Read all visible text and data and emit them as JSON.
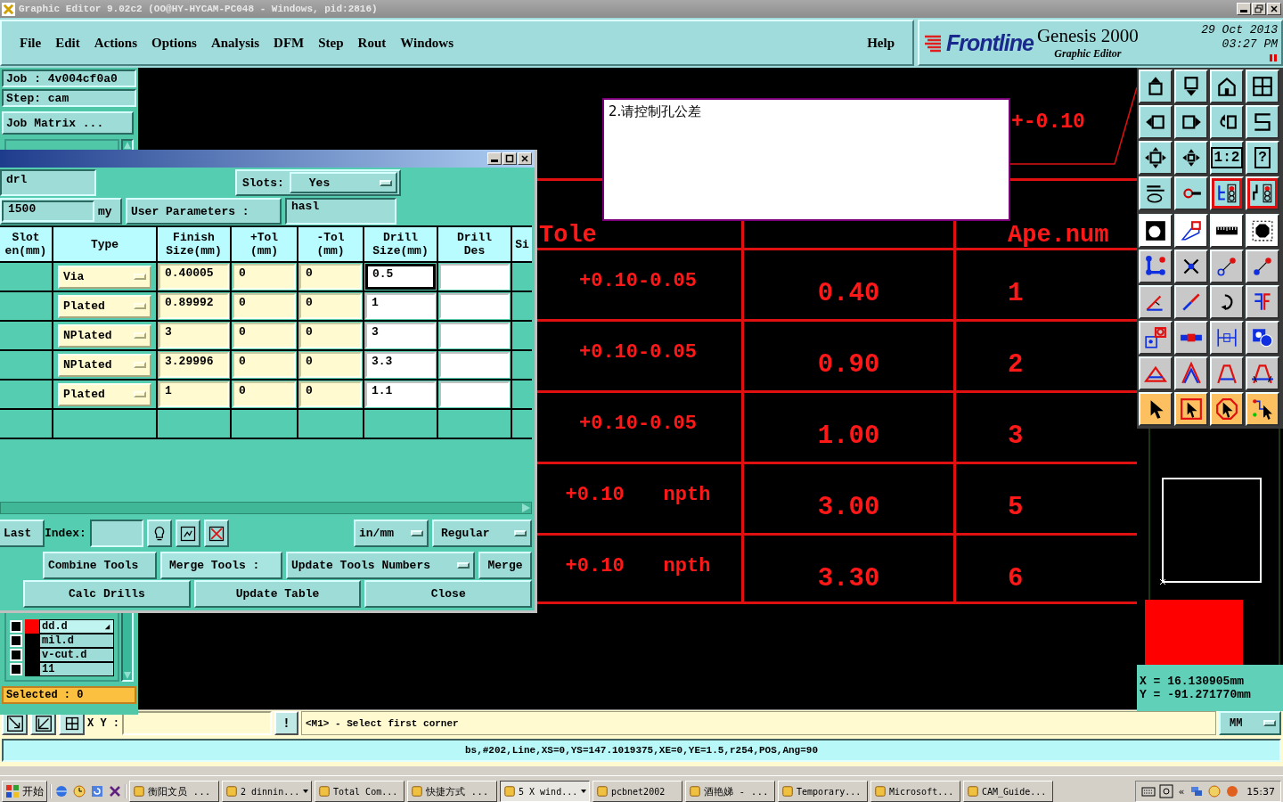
{
  "window": {
    "title": "Graphic Editor 9.02c2 (OO@HY-HYCAM-PC048 - Windows, pid:2816)"
  },
  "menu": [
    "File",
    "Edit",
    "Actions",
    "Options",
    "Analysis",
    "DFM",
    "Step",
    "Rout",
    "Windows"
  ],
  "help": "Help",
  "brand": {
    "logo": "Frontline",
    "product": "Genesis 2000",
    "subtitle": "Graphic Editor",
    "date": "29 Oct 2013",
    "time": "03:27 PM"
  },
  "job": {
    "job": "Job : 4v004cf0a0",
    "step": "Step: cam",
    "matrix_button": "Job Matrix ..."
  },
  "layers": [
    {
      "name": "dd.d",
      "checked": false,
      "color": "#ff0000",
      "current": true
    },
    {
      "name": "mil.d",
      "checked": false,
      "color": "#000000",
      "current": false
    },
    {
      "name": "v-cut.d",
      "checked": false,
      "color": "#000000",
      "current": false
    },
    {
      "name": "11",
      "checked": false,
      "color": "#000000",
      "current": false
    }
  ],
  "selected_count": "Selected : 0",
  "drill_dialog": {
    "layer": "drl",
    "slots_label": "Slots:",
    "slots": "Yes",
    "thickness": "1500",
    "thickness_unit": "my",
    "user_params_button": "User Parameters :",
    "user_params": "hasl",
    "columns": [
      {
        "lines": [
          "Slot",
          "en(mm)"
        ]
      },
      {
        "lines": [
          "Type"
        ]
      },
      {
        "lines": [
          "Finish",
          "Size(mm)"
        ]
      },
      {
        "lines": [
          "+Tol",
          "(mm)"
        ]
      },
      {
        "lines": [
          "-Tol",
          "(mm)"
        ]
      },
      {
        "lines": [
          "Drill",
          "Size(mm)"
        ]
      },
      {
        "lines": [
          "Drill",
          "Des"
        ]
      },
      {
        "lines": [
          "Si"
        ]
      }
    ],
    "rows": [
      {
        "type": "Via",
        "finish": "0.40005",
        "plus_tol": "0",
        "minus_tol": "0",
        "drill_size": "0.5",
        "focused": true
      },
      {
        "type": "Plated",
        "finish": "0.89992",
        "plus_tol": "0",
        "minus_tol": "0",
        "drill_size": "1",
        "focused": false
      },
      {
        "type": "NPlated",
        "finish": "3",
        "plus_tol": "0",
        "minus_tol": "0",
        "drill_size": "3",
        "focused": false
      },
      {
        "type": "NPlated",
        "finish": "3.29996",
        "plus_tol": "0",
        "minus_tol": "0",
        "drill_size": "3.3",
        "focused": false
      },
      {
        "type": "Plated",
        "finish": "1",
        "plus_tol": "0",
        "minus_tol": "0",
        "drill_size": "1.1",
        "focused": false
      }
    ],
    "last_button": "Last",
    "index_label": "Index:",
    "units": "in/mm",
    "mode": "Regular",
    "combine_button": "Combine Tools",
    "merge_label": "Merge Tools :",
    "merge_mode": "Update Tools Numbers",
    "merge_button": "Merge",
    "calc_button": "Calc Drills",
    "update_button": "Update Table",
    "close_button": "Close"
  },
  "canvas": {
    "note": "2.请控制孔公差",
    "tolerance_label": "+-0.10",
    "header": {
      "tolerance": "Tole",
      "ape_num": "Ape.num"
    },
    "rows": [
      {
        "tolerance": "+0.10-0.05",
        "size": "0.40",
        "ape_num": "1"
      },
      {
        "tolerance": "+0.10-0.05",
        "size": "0.90",
        "ape_num": "2"
      },
      {
        "tolerance": "+0.10-0.05",
        "size": "1.00",
        "ape_num": "3"
      },
      {
        "tolerance": "+0.10",
        "hole_type": "npth",
        "size": "3.00",
        "ape_num": "5"
      },
      {
        "tolerance": "+0.10",
        "hole_type": "npth",
        "size": "3.30",
        "ape_num": "6"
      }
    ]
  },
  "tools": [
    {
      "kind": "view",
      "active": false
    },
    {
      "kind": "view",
      "active": false
    },
    {
      "kind": "view",
      "active": false
    },
    {
      "kind": "view",
      "active": false
    },
    {
      "kind": "view",
      "active": false
    },
    {
      "kind": "view",
      "active": false
    },
    {
      "kind": "view",
      "active": false
    },
    {
      "kind": "view",
      "active": false
    },
    {
      "kind": "view",
      "active": false
    },
    {
      "kind": "view",
      "active": false
    },
    {
      "kind": "view",
      "active": false,
      "label": "1:2"
    },
    {
      "kind": "view",
      "active": false,
      "label": "?"
    },
    {
      "kind": "view",
      "active": false
    },
    {
      "kind": "view",
      "active": false
    },
    {
      "kind": "view",
      "active": true
    },
    {
      "kind": "view",
      "active": true
    },
    {
      "kind": "display",
      "active": false
    },
    {
      "kind": "display",
      "active": false
    },
    {
      "kind": "display",
      "active": false
    },
    {
      "kind": "display",
      "active": false
    },
    {
      "kind": "edit",
      "active": false
    },
    {
      "kind": "edit",
      "active": false
    },
    {
      "kind": "edit",
      "active": false
    },
    {
      "kind": "edit",
      "active": false
    },
    {
      "kind": "edit",
      "active": false
    },
    {
      "kind": "edit",
      "active": false
    },
    {
      "kind": "edit",
      "active": false
    },
    {
      "kind": "edit",
      "active": false
    },
    {
      "kind": "edit",
      "active": false
    },
    {
      "kind": "edit",
      "active": false
    },
    {
      "kind": "edit",
      "active": false
    },
    {
      "kind": "edit",
      "active": false
    },
    {
      "kind": "edit",
      "active": false
    },
    {
      "kind": "edit",
      "active": false
    },
    {
      "kind": "edit",
      "active": false
    },
    {
      "kind": "edit",
      "active": false
    },
    {
      "kind": "select",
      "active": false
    },
    {
      "kind": "select",
      "active": false
    },
    {
      "kind": "select",
      "active": false
    },
    {
      "kind": "select",
      "active": false
    }
  ],
  "coords": {
    "x": "X = 16.130905mm",
    "y": "Y = -91.271770mm"
  },
  "command": {
    "label": "X Y :",
    "alert": "!",
    "message": "<M1> - Select first corner",
    "units": "MM"
  },
  "status": "bs,#202,Line,XS=0,YS=147.1019375,XE=0,YE=1.5,r254,POS,Ang=90",
  "taskbar": {
    "start": "开始",
    "tasks": [
      {
        "label": "衡阳文员 ...",
        "group": false,
        "selected": false
      },
      {
        "label": "2 dinnin...",
        "group": true,
        "selected": false
      },
      {
        "label": "Total Com...",
        "group": false,
        "selected": false
      },
      {
        "label": "快捷方式 ...",
        "group": false,
        "selected": false
      },
      {
        "label": "5 X wind...",
        "group": true,
        "selected": true
      },
      {
        "label": "pcbnet2002",
        "group": false,
        "selected": false
      },
      {
        "label": "酒艳娣 - ...",
        "group": false,
        "selected": false
      },
      {
        "label": "Temporary...",
        "group": false,
        "selected": false
      },
      {
        "label": "Microsoft...",
        "group": false,
        "selected": false
      },
      {
        "label": "CAM_Guide...",
        "group": false,
        "selected": false
      }
    ],
    "tray_expand": "«",
    "time": "15:37"
  }
}
